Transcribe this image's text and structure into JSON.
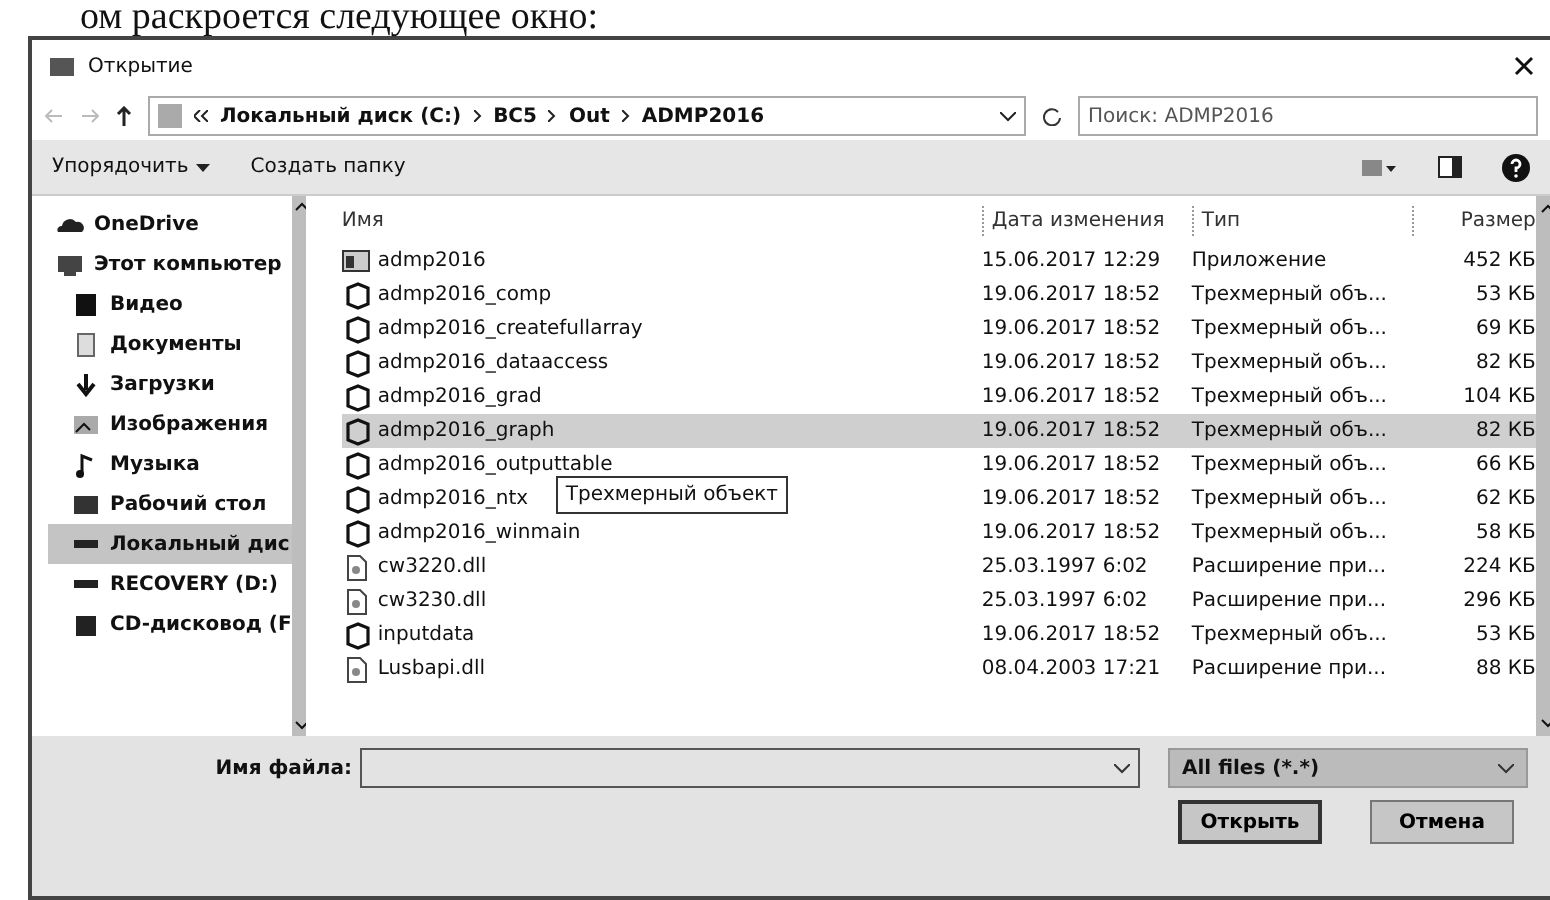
{
  "page_text": "ом раскроется следующее окно:",
  "window": {
    "title": "Открытие"
  },
  "address": {
    "breadcrumb": [
      "Локальный диск (C:)",
      "BC5",
      "Out",
      "ADMP2016"
    ],
    "search_placeholder": "Поиск: ADMP2016"
  },
  "toolbar": {
    "organize": "Упорядочить",
    "new_folder": "Создать папку"
  },
  "sidebar": {
    "items": [
      {
        "label": "OneDrive",
        "kind": "cloud",
        "selected": false
      },
      {
        "label": "Этот компьютер",
        "kind": "pc",
        "selected": false
      },
      {
        "label": "Видео",
        "kind": "video",
        "selected": false
      },
      {
        "label": "Документы",
        "kind": "docs",
        "selected": false
      },
      {
        "label": "Загрузки",
        "kind": "down",
        "selected": false
      },
      {
        "label": "Изображения",
        "kind": "pics",
        "selected": false
      },
      {
        "label": "Музыка",
        "kind": "music",
        "selected": false
      },
      {
        "label": "Рабочий стол",
        "kind": "desk",
        "selected": false
      },
      {
        "label": "Локальный дис",
        "kind": "drive",
        "selected": true
      },
      {
        "label": "RECOVERY (D:)",
        "kind": "drive",
        "selected": false
      },
      {
        "label": "CD-дисковод (F",
        "kind": "cd",
        "selected": false
      }
    ]
  },
  "table": {
    "columns": [
      "Имя",
      "Дата изменения",
      "Тип",
      "Размер"
    ],
    "rows": [
      {
        "kind": "app",
        "cells": [
          "admp2016",
          "15.06.2017 12:29",
          "Приложение",
          "452 КБ"
        ],
        "selected": false
      },
      {
        "kind": "obj",
        "cells": [
          "admp2016_comp",
          "19.06.2017 18:52",
          "Трехмерный объ...",
          "53 КБ"
        ],
        "selected": false
      },
      {
        "kind": "obj",
        "cells": [
          "admp2016_createfullarray",
          "19.06.2017 18:52",
          "Трехмерный объ...",
          "69 КБ"
        ],
        "selected": false
      },
      {
        "kind": "obj",
        "cells": [
          "admp2016_dataaccess",
          "19.06.2017 18:52",
          "Трехмерный объ...",
          "82 КБ"
        ],
        "selected": false
      },
      {
        "kind": "obj",
        "cells": [
          "admp2016_grad",
          "19.06.2017 18:52",
          "Трехмерный объ...",
          "104 КБ"
        ],
        "selected": false
      },
      {
        "kind": "obj",
        "cells": [
          "admp2016_graph",
          "19.06.2017 18:52",
          "Трехмерный объ...",
          "82 КБ"
        ],
        "selected": true
      },
      {
        "kind": "obj",
        "cells": [
          "admp2016_outputtable",
          "19.06.2017 18:52",
          "Трехмерный объ...",
          "66 КБ"
        ],
        "selected": false
      },
      {
        "kind": "obj",
        "cells": [
          "admp2016_ntx",
          "19.06.2017 18:52",
          "Трехмерный объ...",
          "62 КБ"
        ],
        "selected": false
      },
      {
        "kind": "obj",
        "cells": [
          "admp2016_winmain",
          "19.06.2017 18:52",
          "Трехмерный объ...",
          "58 КБ"
        ],
        "selected": false
      },
      {
        "kind": "dll",
        "cells": [
          "cw3220.dll",
          "25.03.1997 6:02",
          "Расширение при...",
          "224 КБ"
        ],
        "selected": false
      },
      {
        "kind": "dll",
        "cells": [
          "cw3230.dll",
          "25.03.1997 6:02",
          "Расширение при...",
          "296 КБ"
        ],
        "selected": false
      },
      {
        "kind": "obj",
        "cells": [
          "inputdata",
          "19.06.2017 18:52",
          "Трехмерный объ...",
          "53 КБ"
        ],
        "selected": false
      },
      {
        "kind": "dll",
        "cells": [
          "Lusbapi.dll",
          "08.04.2003 17:21",
          "Расширение при...",
          "88 КБ"
        ],
        "selected": false
      }
    ]
  },
  "tooltip": "Трехмерный объект",
  "filename": {
    "label": "Имя файла:",
    "filter": "All files (*.*)"
  },
  "buttons": [
    "Открыть",
    "Отмена"
  ]
}
